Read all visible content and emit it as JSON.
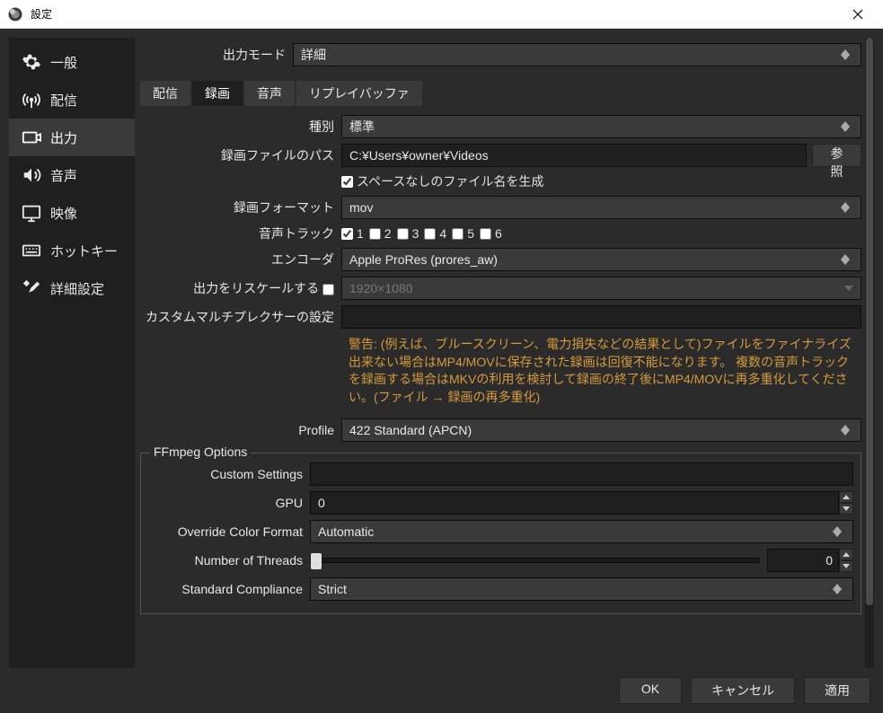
{
  "window": {
    "title": "設定"
  },
  "sidebar": {
    "items": [
      {
        "label": "一般"
      },
      {
        "label": "配信"
      },
      {
        "label": "出力"
      },
      {
        "label": "音声"
      },
      {
        "label": "映像"
      },
      {
        "label": "ホットキー"
      },
      {
        "label": "詳細設定"
      }
    ]
  },
  "output_mode": {
    "label": "出力モード",
    "value": "詳細"
  },
  "tabs": [
    {
      "label": "配信"
    },
    {
      "label": "録画"
    },
    {
      "label": "音声"
    },
    {
      "label": "リプレイバッファ"
    }
  ],
  "rec": {
    "type": {
      "label": "種別",
      "value": "標準"
    },
    "path": {
      "label": "録画ファイルのパス",
      "value": "C:¥Users¥owner¥Videos",
      "browse": "参照"
    },
    "nospace": {
      "label": "スペースなしのファイル名を生成"
    },
    "format": {
      "label": "録画フォーマット",
      "value": "mov"
    },
    "tracks": {
      "label": "音声トラック",
      "items": [
        "1",
        "2",
        "3",
        "4",
        "5",
        "6"
      ]
    },
    "encoder": {
      "label": "エンコーダ",
      "value": "Apple ProRes (prores_aw)"
    },
    "rescale": {
      "label": "出力をリスケールする",
      "value": "1920×1080"
    },
    "muxer": {
      "label": "カスタムマルチプレクサーの設定",
      "value": ""
    },
    "warning": "警告: (例えば、ブルースクリーン、電力損失などの結果として)ファイルをファイナライズ出来ない場合はMP4/MOVに保存された録画は回復不能になります。 複数の音声トラックを録画する場合はMKVの利用を検討して録画の終了後にMP4/MOVに再多重化してください。(ファイル → 録画の再多重化)",
    "profile": {
      "label": "Profile",
      "value": "422 Standard (APCN)"
    }
  },
  "ffmpeg": {
    "legend": "FFmpeg Options",
    "custom": {
      "label": "Custom Settings",
      "value": ""
    },
    "gpu": {
      "label": "GPU",
      "value": "0"
    },
    "colorfmt": {
      "label": "Override Color Format",
      "value": "Automatic"
    },
    "threads": {
      "label": "Number of Threads",
      "value": "0"
    },
    "compliance": {
      "label": "Standard Compliance",
      "value": "Strict"
    }
  },
  "footer": {
    "ok": "OK",
    "cancel": "キャンセル",
    "apply": "適用"
  }
}
